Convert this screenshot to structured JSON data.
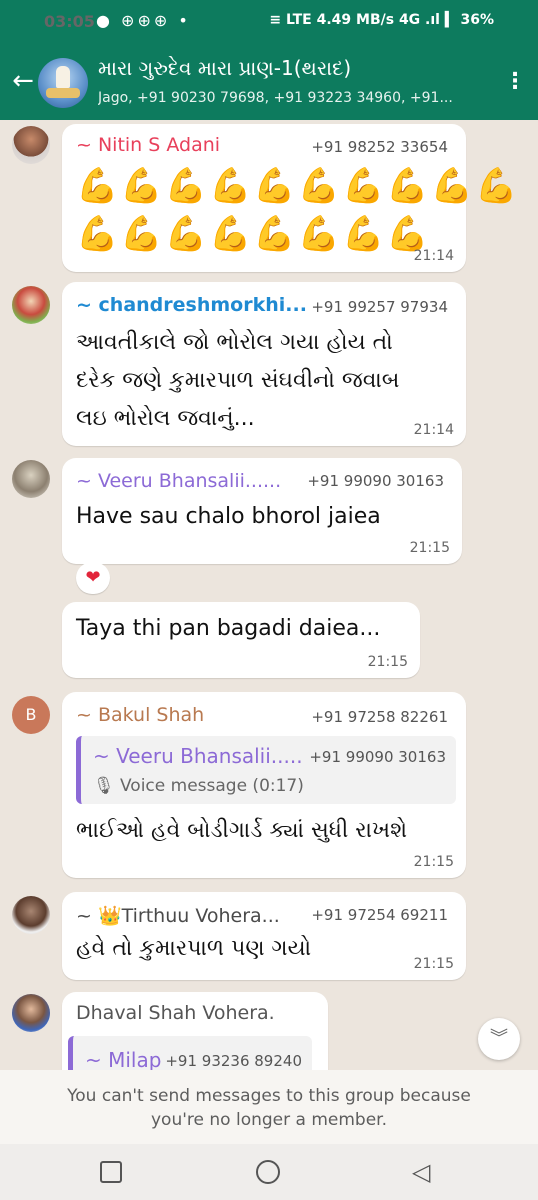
{
  "status": {
    "time": "03:05",
    "notif_icons": "● ⊕⊕⊕ •",
    "right": "≡ LTE 4.49 MB/s 4G .ıl ▍ 36%"
  },
  "header": {
    "group_name": "મારા ગુરુદેવ મારા પ્રાણ-1(થરાદ)",
    "members": "Jago, +91 90230 79698, +91 93223 34960, +91...",
    "back_icon": "arrow-back-icon",
    "menu_icon": "more-vertical-icon"
  },
  "colors": {
    "header_bg": "#0d7b5e",
    "chat_bg": "#ece5dd",
    "nitin": "#e8405b",
    "chandresh": "#1f8ad2",
    "veeru": "#8c6ad6",
    "bakul": "#b87950",
    "tirthuu": "#4a4a4a",
    "dhaval": "#555555"
  },
  "messages": [
    {
      "sender": "~ Nitin S Adani",
      "phone": "+91 98252 33654",
      "row1": "💪💪💪💪💪💪💪💪💪💪",
      "row2": "💪💪💪💪💪💪💪💪",
      "time": "21:14"
    },
    {
      "sender": "~ chandreshmorkhi...",
      "phone": "+91 99257 97934",
      "text1": "આવતીકાલે જો ભોરોલ ગયા હોય તો",
      "text2": "દરેક જણે કુમારપાળ સંઘવીનો જવાબ",
      "text3": "લઇ ભોરોલ જવાનું...",
      "time": "21:14"
    },
    {
      "sender": "~ Veeru Bhansalii......",
      "phone": "+91 99090 30163",
      "text": "Have sau chalo bhorol jaiea",
      "time": "21:15",
      "reaction": "❤"
    },
    {
      "text": "Taya thi pan bagadi daiea...",
      "time": "21:15"
    },
    {
      "avatar_letter": "B",
      "sender": "~ Bakul Shah",
      "phone": "+91 97258 82261",
      "quote_sender": "~ Veeru Bhansalii.....",
      "quote_phone": "+91 99090 30163",
      "quote_voice": "🎙 Voice message (0:17)",
      "text": "ભાઈઓ હવે બોડીગાર્ડ ક્યાં સુધી રાખશે",
      "time": "21:15"
    },
    {
      "sender": "~ 👑Tirthuu Vohera...",
      "phone": "+91 97254 69211",
      "text": "હવે તો કુમારપાળ પણ ગયો",
      "time": "21:15"
    },
    {
      "sender": "Dhaval Shah Vohera.",
      "quote_sender": "~ Milap",
      "quote_phone": "+91 93236 89240"
    }
  ],
  "scroll_icon": "chevrons-down-icon",
  "notice": "You can't send messages to this group because you're no longer a member.",
  "navbar": {
    "recent_icon": "recents-square-icon",
    "home_icon": "home-circle-icon",
    "back_icon": "back-triangle-icon",
    "back_glyph": "◁"
  }
}
